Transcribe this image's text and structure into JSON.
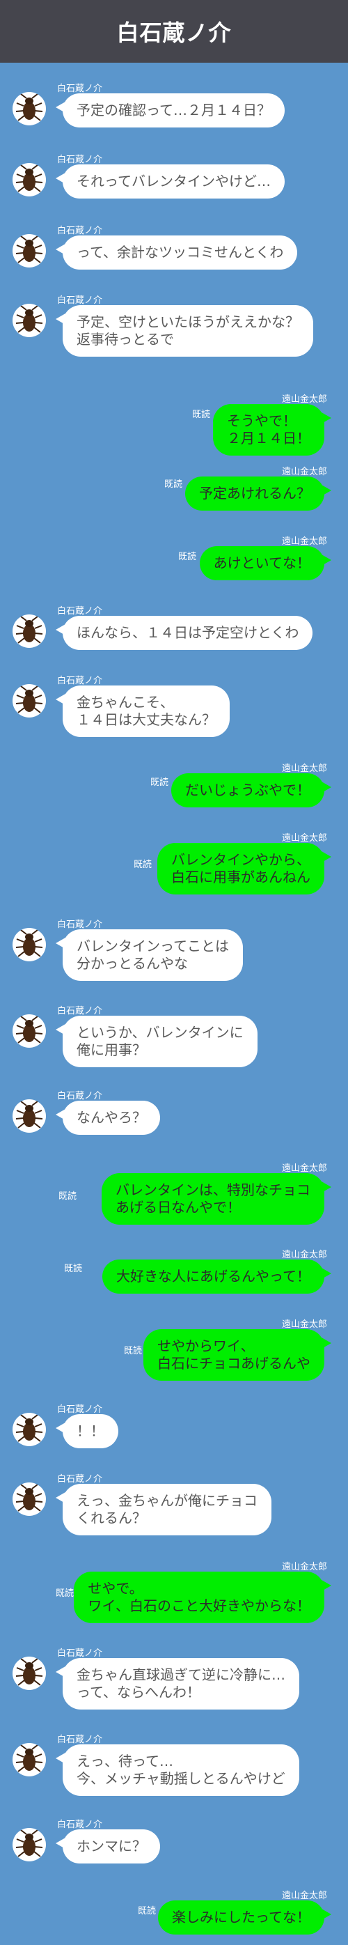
{
  "header": {
    "title": "白石蔵ノ介"
  },
  "characters": {
    "left": "白石蔵ノ介",
    "right": "遠山金太郎"
  },
  "read_label": "既読",
  "colors": {
    "background": "#5b96cc",
    "header": "#45454d",
    "left_bubble": "#ffffff",
    "right_bubble": "#00ee00"
  },
  "messages": [
    {
      "speaker": "白石蔵ノ介",
      "text": "予定の確認って…２月１４日？"
    },
    {
      "speaker": "白石蔵ノ介",
      "text": "それってバレンタインやけど…"
    },
    {
      "speaker": "白石蔵ノ介",
      "text": "って、余計なツッコミせんとくわ"
    },
    {
      "speaker": "白石蔵ノ介",
      "text": "予定、空けといたほうがええかな？\n返事待っとるで"
    },
    {
      "speaker": "遠山金太郎",
      "text": "そうやで！\n２月１４日！",
      "read": "既読"
    },
    {
      "speaker": "遠山金太郎",
      "text": "予定あけれるん？",
      "read": "既読"
    },
    {
      "speaker": "遠山金太郎",
      "text": "あけといてな！",
      "read": "既読"
    },
    {
      "speaker": "白石蔵ノ介",
      "text": "ほんなら、１４日は予定空けとくわ"
    },
    {
      "speaker": "白石蔵ノ介",
      "text": "金ちゃんこそ、\n１４日は大丈夫なん？"
    },
    {
      "speaker": "遠山金太郎",
      "text": "だいじょうぶやで！",
      "read": "既読"
    },
    {
      "speaker": "遠山金太郎",
      "text": "バレンタインやから、\n白石に用事があんねん",
      "read": "既読"
    },
    {
      "speaker": "白石蔵ノ介",
      "text": "バレンタインってことは\n分かっとるんやな"
    },
    {
      "speaker": "白石蔵ノ介",
      "text": "というか、バレンタインに\n俺に用事？"
    },
    {
      "speaker": "白石蔵ノ介",
      "text": "なんやろ？"
    },
    {
      "speaker": "遠山金太郎",
      "text": "バレンタインは、特別なチョコ\nあげる日なんやで！",
      "read": "既読"
    },
    {
      "speaker": "遠山金太郎",
      "text": "大好きな人にあげるんやって！",
      "read": "既読"
    },
    {
      "speaker": "遠山金太郎",
      "text": "せやからワイ、\n白石にチョコあげるんや",
      "read": "既読"
    },
    {
      "speaker": "白石蔵ノ介",
      "text": "！！"
    },
    {
      "speaker": "白石蔵ノ介",
      "text": "えっ、金ちゃんが俺にチョコ\nくれるん？"
    },
    {
      "speaker": "遠山金太郎",
      "text": "せやで。\nワイ、白石のこと大好きやからな！",
      "read": "既読"
    },
    {
      "speaker": "白石蔵ノ介",
      "text": "金ちゃん直球過ぎて逆に冷静に…\nって、ならへんわ！"
    },
    {
      "speaker": "白石蔵ノ介",
      "text": "えっ、待って…\n今、メッチャ動揺しとるんやけど"
    },
    {
      "speaker": "白石蔵ノ介",
      "text": "ホンマに？"
    },
    {
      "speaker": "遠山金太郎",
      "text": "楽しみにしたってな！",
      "read": "既読"
    }
  ]
}
